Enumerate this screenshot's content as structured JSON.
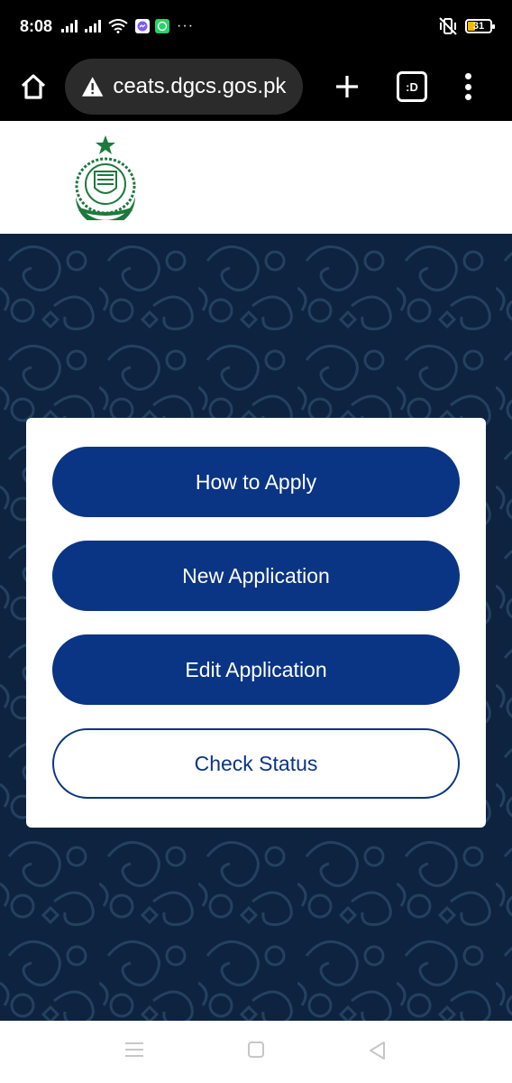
{
  "status_bar": {
    "time": "8:08",
    "battery_level": "31",
    "more_indicator": "···"
  },
  "browser": {
    "url": "ceats.dgcs.gos.pk",
    "tab_count_label": ":D"
  },
  "menu": {
    "how_to_apply": "How to Apply",
    "new_application": "New Application",
    "edit_application": "Edit Application",
    "check_status": "Check Status"
  },
  "colors": {
    "primary": "#0a3585",
    "background_pattern": "#0d2340",
    "logo_green": "#1c7a3c"
  },
  "icons": [
    "home-icon",
    "warning-icon",
    "plus-icon",
    "tab-switcher-icon",
    "more-vert-icon",
    "menu-icon",
    "square-icon",
    "back-icon"
  ]
}
